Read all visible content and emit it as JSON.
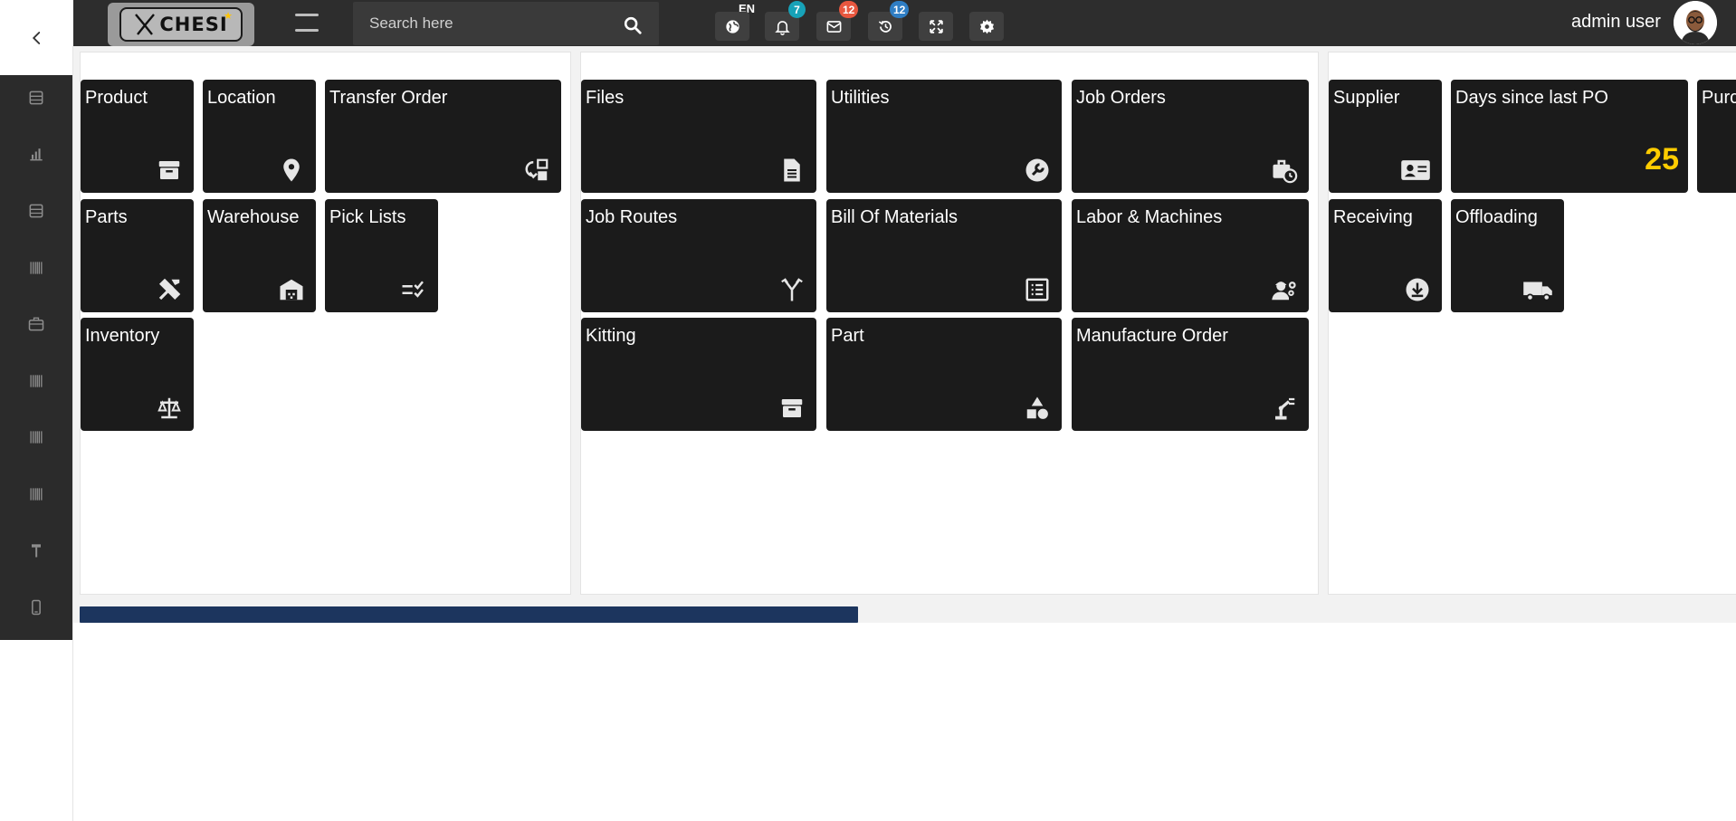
{
  "header": {
    "search": {
      "placeholder": "Search here"
    },
    "language": "EN",
    "notifications": {
      "badge": "7",
      "badge_color": "#17a2b8"
    },
    "messages": {
      "badge": "12",
      "badge_color": "#e8573f"
    },
    "history": {
      "badge": "12",
      "badge_color": "#2f7ec4"
    },
    "user_name": "admin user",
    "icons": [
      "globe-icon",
      "bell-icon",
      "envelope-icon",
      "history-icon",
      "expand-icon",
      "gear-icon"
    ]
  },
  "sidebar": {
    "items": [
      "inbox-icon",
      "chart-bar-icon",
      "inbox-icon",
      "barcode-icon",
      "briefcase-icon",
      "barcode-icon",
      "barcode-icon",
      "barcode-icon",
      "hammer-icon",
      "mobile-icon"
    ]
  },
  "panels": {
    "inventory": {
      "tiles": [
        {
          "label": "Product",
          "icon": "archive-icon"
        },
        {
          "label": "Location",
          "icon": "map-pin-icon"
        },
        {
          "label": "Transfer Order",
          "icon": "transfer-icon"
        },
        {
          "label": "Parts",
          "icon": "tools-icon"
        },
        {
          "label": "Warehouse",
          "icon": "warehouse-icon"
        },
        {
          "label": "Pick Lists",
          "icon": "checklist-icon"
        },
        {
          "label": "Inventory",
          "icon": "scale-icon"
        }
      ]
    },
    "manufacturing": {
      "tiles": [
        {
          "label": "Files",
          "icon": "file-icon"
        },
        {
          "label": "Utilities",
          "icon": "wrench-icon"
        },
        {
          "label": "Job Orders",
          "icon": "briefcase-clock-icon"
        },
        {
          "label": "Job Routes",
          "icon": "route-icon"
        },
        {
          "label": "Bill Of Materials",
          "icon": "list-icon"
        },
        {
          "label": "Labor & Machines",
          "icon": "worker-gear-icon"
        },
        {
          "label": "Kitting",
          "icon": "archive-icon"
        },
        {
          "label": "Part",
          "icon": "shapes-icon"
        },
        {
          "label": "Manufacture Order",
          "icon": "robot-arm-icon"
        }
      ]
    },
    "purchasing": {
      "tiles": [
        {
          "label": "Supplier",
          "icon": "id-card-icon"
        },
        {
          "label": "Days since last PO",
          "value": "25",
          "value_color": "#ffcc00"
        },
        {
          "label": "Purc"
        },
        {
          "label": "Receiving",
          "icon": "download-icon"
        },
        {
          "label": "Offloading",
          "icon": "truck-icon"
        }
      ]
    }
  },
  "scroll_progress": {
    "percent": 47,
    "color": "#1c355e"
  }
}
